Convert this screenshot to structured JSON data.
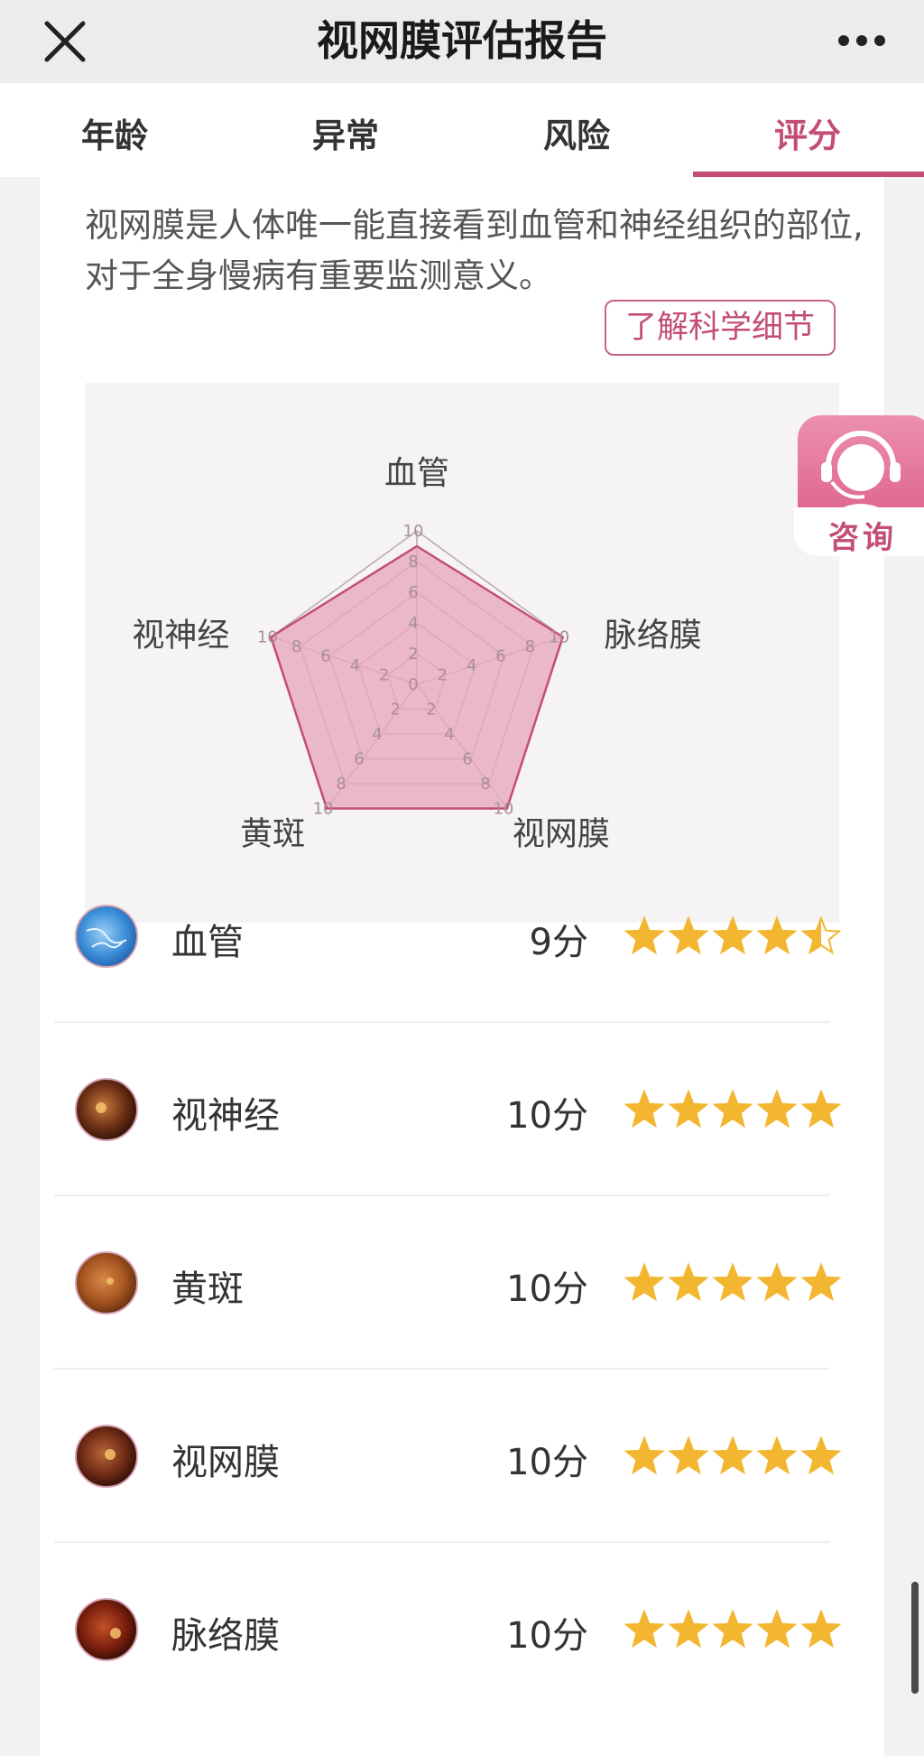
{
  "header": {
    "title": "视网膜评估报告"
  },
  "tabs": [
    {
      "label": "年龄",
      "active": false
    },
    {
      "label": "异常",
      "active": false
    },
    {
      "label": "风险",
      "active": false
    },
    {
      "label": "评分",
      "active": true
    }
  ],
  "intro": {
    "text": "视网膜是人体唯一能直接看到血管和神经组织的部位,对于全身慢病有重要监测意义。",
    "detail_button": "了解科学细节"
  },
  "consult": {
    "label": "咨询"
  },
  "chart_data": {
    "type": "radar",
    "axes": [
      "血管",
      "脉络膜",
      "视网膜",
      "黄斑",
      "视神经"
    ],
    "ticks": [
      0,
      2,
      4,
      6,
      8,
      10
    ],
    "range": [
      0,
      10
    ],
    "values": [
      9,
      10,
      10,
      10,
      10
    ],
    "colors": {
      "fill": "#e9a8bf",
      "stroke": "#c44d78"
    }
  },
  "scores": [
    {
      "name": "血管",
      "score": "9分",
      "rating": 4.5,
      "icon": "retina-vessel-icon"
    },
    {
      "name": "视神经",
      "score": "10分",
      "rating": 5,
      "icon": "optic-nerve-fundus-icon"
    },
    {
      "name": "黄斑",
      "score": "10分",
      "rating": 5,
      "icon": "macula-fundus-icon"
    },
    {
      "name": "视网膜",
      "score": "10分",
      "rating": 5,
      "icon": "retina-fundus-icon"
    },
    {
      "name": "脉络膜",
      "score": "10分",
      "rating": 5,
      "icon": "choroid-fundus-icon"
    }
  ],
  "colors": {
    "accent": "#c44d78",
    "star": "#f3b631"
  }
}
